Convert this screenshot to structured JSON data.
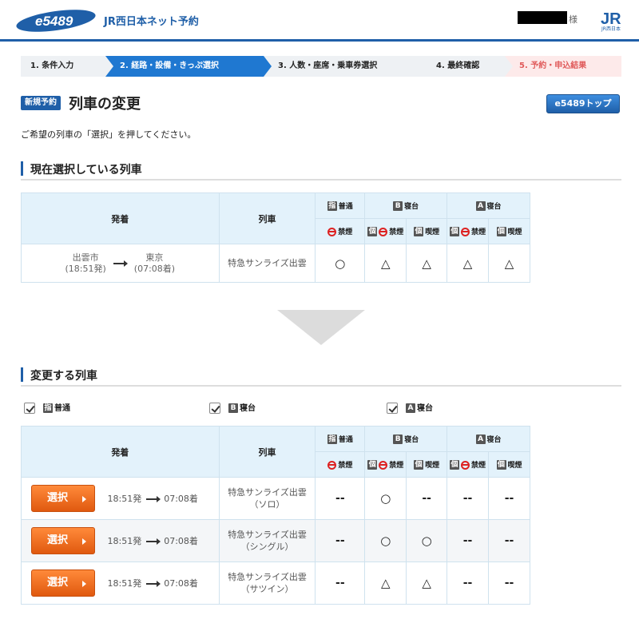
{
  "header": {
    "logo_text": "e5489",
    "site_name": "JR西日本ネット予約",
    "user_suffix": "様",
    "jr_logo_text": "JR西日本",
    "colors": {
      "brand": "#1f5fa8",
      "accent": "#1f78d1"
    }
  },
  "steps": [
    {
      "label": "1. 条件入力",
      "state": "done"
    },
    {
      "label": "2. 経路・設備・きっぷ選択",
      "state": "current"
    },
    {
      "label": "3. 人数・座席・乗車券選択",
      "state": "todo"
    },
    {
      "label": "4. 最終確認",
      "state": "todo"
    },
    {
      "label": "5. 予約・申込結果",
      "state": "final"
    }
  ],
  "title": {
    "badge": "新規予約",
    "text": "列車の変更",
    "top_button": "e5489トップ"
  },
  "instruction": "ご希望の列車の「選択」を押してください。",
  "columns": {
    "departure": "発着",
    "train": "列車",
    "normal": "普通",
    "normal_icon": "指",
    "b_sleeper": "寝台",
    "b_icon": "B",
    "a_sleeper": "寝台",
    "a_icon": "A",
    "no_smoking": "禁煙",
    "private_icon": "個",
    "smoking": "喫煙"
  },
  "current": {
    "heading": "現在選択している列車",
    "row": {
      "from": "出雲市",
      "from_time": "(18:51発)",
      "to": "東京",
      "to_time": "(07:08着)",
      "train": "特急サンライズ出雲",
      "availability": [
        "○",
        "△",
        "△",
        "△",
        "△"
      ]
    }
  },
  "change": {
    "heading": "変更する列車",
    "filters": [
      {
        "icon": "指",
        "label": "普通",
        "checked": true
      },
      {
        "icon": "B",
        "label": "寝台",
        "checked": true
      },
      {
        "icon": "A",
        "label": "寝台",
        "checked": true
      }
    ],
    "select_label": "選択",
    "rows": [
      {
        "dep": "18:51発",
        "arr": "07:08着",
        "train": "特急サンライズ出雲",
        "sub": "（ソロ）",
        "availability": [
          "--",
          "○",
          "--",
          "--",
          "--"
        ]
      },
      {
        "dep": "18:51発",
        "arr": "07:08着",
        "train": "特急サンライズ出雲",
        "sub": "（シングル）",
        "availability": [
          "--",
          "○",
          "○",
          "--",
          "--"
        ]
      },
      {
        "dep": "18:51発",
        "arr": "07:08着",
        "train": "特急サンライズ出雲",
        "sub": "（サツイン）",
        "availability": [
          "--",
          "△",
          "△",
          "--",
          "--"
        ]
      }
    ]
  }
}
